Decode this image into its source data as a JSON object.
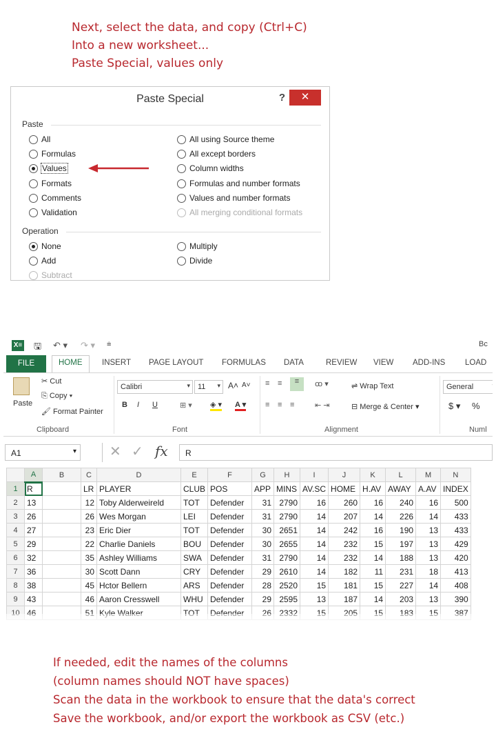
{
  "top_note": [
    "Next, select the data, and copy (Ctrl+C)",
    "Into a new worksheet...",
    "Paste Special, values only"
  ],
  "dialog": {
    "title": "Paste Special",
    "help": "?",
    "close": "✕",
    "paste_label": "Paste",
    "paste_left": [
      {
        "label": "All",
        "selected": false
      },
      {
        "label": "Formulas",
        "selected": false
      },
      {
        "label": "Values",
        "selected": true
      },
      {
        "label": "Formats",
        "selected": false
      },
      {
        "label": "Comments",
        "selected": false
      },
      {
        "label": "Validation",
        "selected": false
      }
    ],
    "paste_right": [
      {
        "label": "All using Source theme",
        "disabled": false
      },
      {
        "label": "All except borders",
        "disabled": false
      },
      {
        "label": "Column widths",
        "disabled": false
      },
      {
        "label": "Formulas and number formats",
        "disabled": false
      },
      {
        "label": "Values and number formats",
        "disabled": false
      },
      {
        "label": "All merging conditional formats",
        "disabled": true
      }
    ],
    "operation_label": "Operation",
    "operation_left": [
      {
        "label": "None",
        "selected": true
      },
      {
        "label": "Add",
        "selected": false
      },
      {
        "label": "Subtract",
        "selected": false
      }
    ],
    "operation_right": [
      {
        "label": "Multiply",
        "selected": false
      },
      {
        "label": "Divide",
        "selected": false
      }
    ],
    "arrow_color": "#c8282e"
  },
  "excel": {
    "title_partial": "Bc",
    "tabs": [
      "FILE",
      "HOME",
      "INSERT",
      "PAGE LAYOUT",
      "FORMULAS",
      "DATA",
      "REVIEW",
      "VIEW",
      "ADD-INS",
      "LOAD"
    ],
    "clipboard": {
      "paste": "Paste",
      "cut": "Cut",
      "copy": "Copy",
      "format_painter": "Format Painter",
      "label": "Clipboard"
    },
    "font": {
      "name": "Calibri",
      "size": "11",
      "grow": "A˄",
      "shrink": "A˅",
      "bold": "B",
      "italic": "I",
      "underline": "U",
      "label": "Font"
    },
    "alignment": {
      "wrap_text": "Wrap Text",
      "merge_center": "Merge & Center",
      "label": "Alignment"
    },
    "number": {
      "format": "General",
      "currency": "$",
      "percent": "%",
      "label": "Numl"
    },
    "name_box": "A1",
    "formula": "R",
    "columns": [
      "A",
      "B",
      "C",
      "D",
      "E",
      "F",
      "G",
      "H",
      "I",
      "J",
      "K",
      "L",
      "M",
      "N"
    ],
    "rows": [
      {
        "n": "1",
        "cells": [
          "R",
          "",
          "LR",
          "PLAYER",
          "CLUB",
          "POS",
          "APP",
          "MINS",
          "AV.SC",
          "HOME",
          "H.AV",
          "AWAY",
          "A.AV",
          "INDEX"
        ]
      },
      {
        "n": "2",
        "cells": [
          "13",
          "",
          "12",
          "Toby Alderweireld",
          "TOT",
          "Defender",
          "31",
          "2790",
          "16",
          "260",
          "16",
          "240",
          "16",
          "500"
        ]
      },
      {
        "n": "3",
        "cells": [
          "26",
          "",
          "26",
          "Wes Morgan",
          "LEI",
          "Defender",
          "31",
          "2790",
          "14",
          "207",
          "14",
          "226",
          "14",
          "433"
        ]
      },
      {
        "n": "4",
        "cells": [
          "27",
          "",
          "23",
          "Eric Dier",
          "TOT",
          "Defender",
          "30",
          "2651",
          "14",
          "242",
          "16",
          "190",
          "13",
          "433"
        ]
      },
      {
        "n": "5",
        "cells": [
          "29",
          "",
          "22",
          "Charlie Daniels",
          "BOU",
          "Defender",
          "30",
          "2655",
          "14",
          "232",
          "15",
          "197",
          "13",
          "429"
        ]
      },
      {
        "n": "6",
        "cells": [
          "32",
          "",
          "35",
          "Ashley Williams",
          "SWA",
          "Defender",
          "31",
          "2790",
          "14",
          "232",
          "14",
          "188",
          "13",
          "420"
        ]
      },
      {
        "n": "7",
        "cells": [
          "36",
          "",
          "30",
          "Scott Dann",
          "CRY",
          "Defender",
          "29",
          "2610",
          "14",
          "182",
          "11",
          "231",
          "18",
          "413"
        ]
      },
      {
        "n": "8",
        "cells": [
          "38",
          "",
          "45",
          "Hctor Bellern",
          "ARS",
          "Defender",
          "28",
          "2520",
          "15",
          "181",
          "15",
          "227",
          "14",
          "408"
        ]
      },
      {
        "n": "9",
        "cells": [
          "43",
          "",
          "46",
          "Aaron Cresswell",
          "WHU",
          "Defender",
          "29",
          "2595",
          "13",
          "187",
          "14",
          "203",
          "13",
          "390"
        ]
      },
      {
        "n": "10",
        "cells": [
          "46",
          "",
          "51",
          "Kyle Walker",
          "TOT",
          "Defender",
          "26",
          "2332",
          "15",
          "205",
          "15",
          "183",
          "15",
          "387"
        ]
      }
    ],
    "accent": "#217346"
  },
  "bottom_note": [
    "If needed, edit the names of the columns",
    "(column names should NOT have spaces)",
    "Scan the data in the workbook to ensure that the data's correct",
    "Save the workbook, and/or export the workbook as CSV (etc.)"
  ]
}
